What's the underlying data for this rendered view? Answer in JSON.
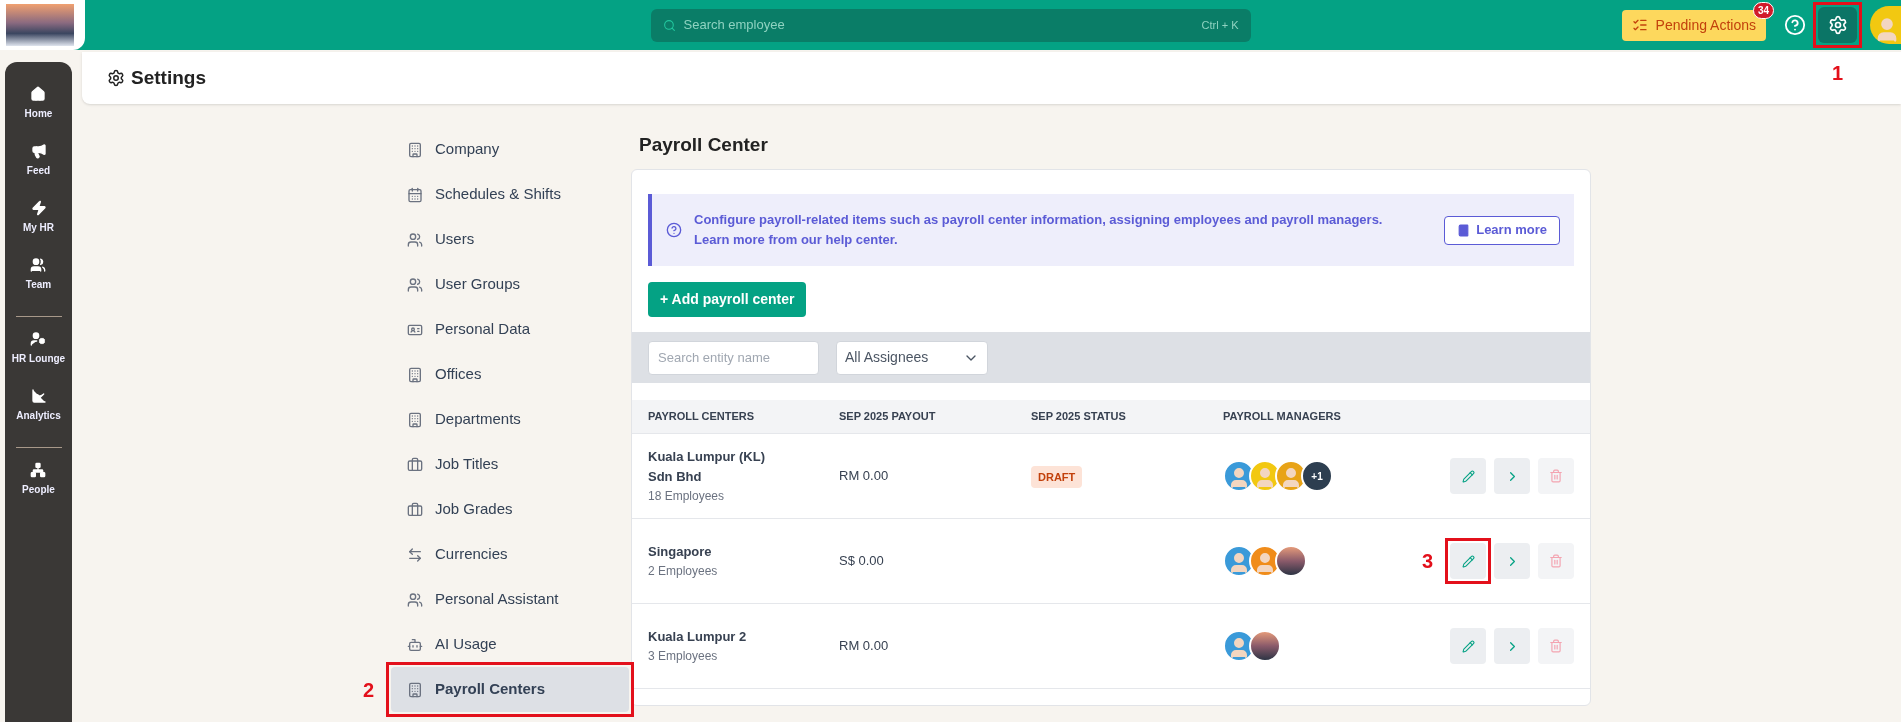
{
  "topbar": {
    "search_placeholder": "Search employee",
    "shortcut": "Ctrl + K",
    "pending_label": "Pending Actions",
    "pending_count": "34",
    "settings_callout": "1"
  },
  "nav_groups": [
    [
      {
        "label": "Home"
      },
      {
        "label": "Feed"
      },
      {
        "label": "My HR"
      },
      {
        "label": "Team"
      }
    ],
    [
      {
        "label": "HR Lounge"
      },
      {
        "label": "Analytics"
      }
    ],
    [
      {
        "label": "People"
      }
    ]
  ],
  "page_title": "Settings",
  "settings_menu": [
    {
      "label": "Company",
      "selected": false
    },
    {
      "label": "Schedules & Shifts",
      "selected": false
    },
    {
      "label": "Users",
      "selected": false
    },
    {
      "label": "User Groups",
      "selected": false
    },
    {
      "label": "Personal Data",
      "selected": false
    },
    {
      "label": "Offices",
      "selected": false
    },
    {
      "label": "Departments",
      "selected": false
    },
    {
      "label": "Job Titles",
      "selected": false
    },
    {
      "label": "Job Grades",
      "selected": false
    },
    {
      "label": "Currencies",
      "selected": false
    },
    {
      "label": "Personal Assistant",
      "selected": false
    },
    {
      "label": "AI Usage",
      "selected": false
    },
    {
      "label": "Payroll Centers",
      "selected": true,
      "callout": "2"
    }
  ],
  "section_title": "Payroll Center",
  "info": {
    "lines": [
      "Configure payroll-related items such as payroll center information, assigning employees and payroll managers.",
      "Learn more from our help center."
    ],
    "button": "Learn more"
  },
  "add_button": "+ Add payroll center",
  "filters": {
    "search_placeholder": "Search entity name",
    "assignee": "All Assignees"
  },
  "table": {
    "columns": [
      "PAYROLL CENTERS",
      "SEP 2025 PAYOUT",
      "SEP 2025 STATUS",
      "PAYROLL MANAGERS"
    ],
    "rows": [
      {
        "name": "Kuala Lumpur (KL) Sdn Bhd",
        "employees": "18 Employees",
        "payout": "RM 0.00",
        "status": "DRAFT",
        "managers": [
          {
            "kind": "person",
            "color": "#3a9ad9"
          },
          {
            "kind": "person",
            "color": "#f2c811"
          },
          {
            "kind": "person",
            "color": "#e8a317"
          }
        ],
        "more": "+1"
      },
      {
        "name": "Singapore",
        "employees": "2 Employees",
        "payout": "S$ 0.00",
        "managers": [
          {
            "kind": "person",
            "color": "#3a9ad9"
          },
          {
            "kind": "person",
            "color": "#f08c1a"
          },
          {
            "kind": "photo"
          }
        ],
        "edit_callout": "3"
      },
      {
        "name": "Kuala Lumpur 2",
        "employees": "3 Employees",
        "payout": "RM 0.00",
        "managers": [
          {
            "kind": "person",
            "color": "#3a9ad9"
          },
          {
            "kind": "photo"
          }
        ]
      }
    ]
  }
}
